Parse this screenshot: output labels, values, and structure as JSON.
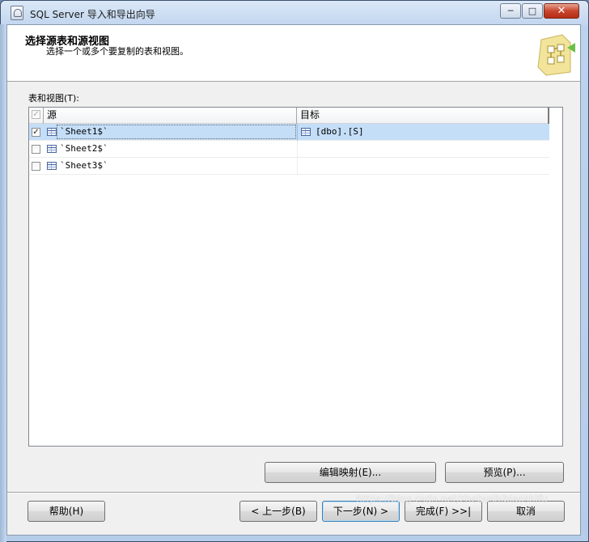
{
  "window": {
    "title": "SQL Server 导入和导出向导",
    "min_glyph": "─",
    "max_glyph": "□",
    "close_glyph": "✕"
  },
  "header": {
    "title": "选择源表和源视图",
    "subtitle": "选择一个或多个要复制的表和视图。"
  },
  "section_label": "表和视图(T):",
  "table": {
    "columns": {
      "source": "源",
      "destination": "目标"
    },
    "rows": [
      {
        "checked": true,
        "source": "`Sheet1$`",
        "destination": "[dbo].[S]",
        "selected": true
      },
      {
        "checked": false,
        "source": "`Sheet2$`",
        "destination": "",
        "selected": false
      },
      {
        "checked": false,
        "source": "`Sheet3$`",
        "destination": "",
        "selected": false
      }
    ]
  },
  "buttons": {
    "edit_mappings": "编辑映射(E)...",
    "preview": "预览(P)...",
    "help": "帮助(H)",
    "back": "< 上一步(B)",
    "next": "下一步(N) >",
    "finish": "完成(F) >>|",
    "cancel": "取消"
  },
  "watermark": "https://blog.csdn.net/zhebushibiaoshifu"
}
